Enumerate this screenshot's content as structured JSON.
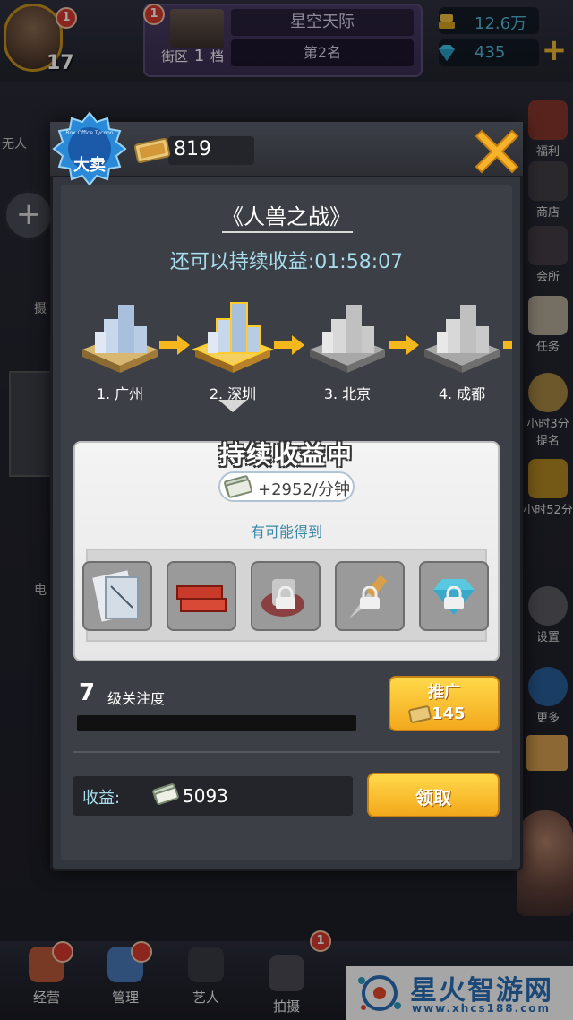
{
  "topbar": {
    "avatar_badge": "1",
    "level": "17",
    "street_badge": "1",
    "street_label_prefix": "街区",
    "street_level": "1",
    "street_label_suffix": "档",
    "street_name": "星空天际",
    "street_rank": "第2名",
    "coins": "12.6万",
    "diamonds": "435"
  },
  "side_left": [
    {
      "label": "无人"
    },
    {
      "label": "摄"
    },
    {
      "label": "电"
    }
  ],
  "side_right": [
    {
      "label": "福利"
    },
    {
      "label": "商店"
    },
    {
      "label": "会所"
    },
    {
      "label": "任务"
    },
    {
      "label": "小时3分"
    },
    {
      "label": "提名"
    },
    {
      "label": "小时52分"
    },
    {
      "label": "设置"
    },
    {
      "label": "更多"
    }
  ],
  "modal": {
    "badge_text": "大卖",
    "badge_subtext": "Box Office Tycoon",
    "tickets": "819",
    "movie_title": "《人兽之战》",
    "countdown_label": "还可以持续收益:",
    "countdown_value": "01:58:07",
    "cities": [
      {
        "label": "1. 广州",
        "state": "done"
      },
      {
        "label": "2. 深圳",
        "state": "current"
      },
      {
        "label": "3. 北京",
        "state": "locked"
      },
      {
        "label": "4. 成都",
        "state": "locked"
      }
    ],
    "earning_title": "持续收益中",
    "earning_rate": "+2952/分钟",
    "possible_label": "有可能得到",
    "items": [
      {
        "name": "blueprint",
        "locked": false
      },
      {
        "name": "bricks",
        "locked": false
      },
      {
        "name": "scroll",
        "locked": true
      },
      {
        "name": "dagger",
        "locked": true
      },
      {
        "name": "diamond",
        "locked": true
      }
    ],
    "attention_level": "7",
    "attention_label": "级关注度",
    "promote_label": "推广",
    "promote_cost": "145",
    "income_label": "收益:",
    "income_value": "5093",
    "claim_label": "领取"
  },
  "bottomnav": [
    {
      "label": "经营"
    },
    {
      "label": "管理"
    },
    {
      "label": "艺人"
    },
    {
      "label": "拍摄"
    }
  ],
  "watermark": {
    "title": "星火智游网",
    "url": "www.xhcs188.com"
  }
}
